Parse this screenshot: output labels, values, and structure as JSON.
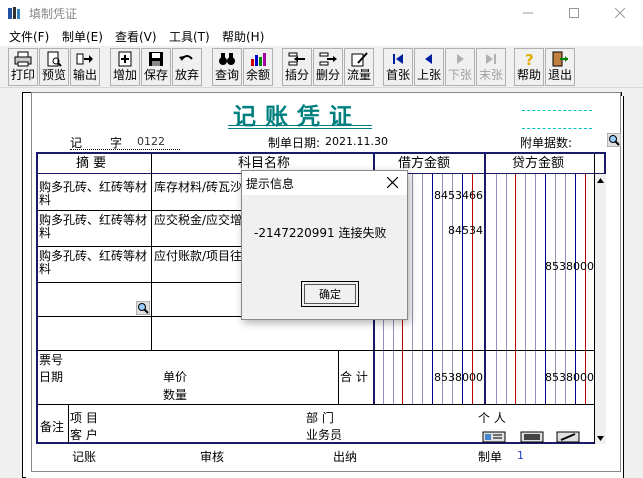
{
  "window": {
    "title": "填制凭证"
  },
  "menu": [
    "文件(F)",
    "制单(E)",
    "查看(V)",
    "工具(T)",
    "帮助(H)"
  ],
  "toolbar": {
    "print": "打印",
    "preview": "预览",
    "export": "输出",
    "add": "增加",
    "save": "保存",
    "discard": "放弃",
    "query": "查询",
    "balance": "余额",
    "insert": "插分",
    "delete": "删分",
    "flow": "流量",
    "first": "首张",
    "prev": "上张",
    "next": "下张",
    "last": "末张",
    "help": "帮助",
    "exit": "退出"
  },
  "voucher": {
    "title": "记账凭证",
    "type_label": "记",
    "num_label": "字",
    "num_value": "0122",
    "date_label": "制单日期:",
    "date_value": "2021.11.30",
    "attach_label": "附单据数:",
    "headers": {
      "summary": "摘 要",
      "account": "科目名称",
      "debit": "借方金额",
      "credit": "贷方金额"
    },
    "rows": [
      {
        "summary": "购多孔砖、红砖等材料",
        "account": "库存材料/砖瓦沙",
        "debit": "8453466",
        "credit": ""
      },
      {
        "summary": "购多孔砖、红砖等材料",
        "account": "应交税金/应交增",
        "debit": "84534",
        "credit": ""
      },
      {
        "summary": "购多孔砖、红砖等材料",
        "account": "应付账款/项目往",
        "debit": "",
        "credit": "8538000"
      },
      {
        "summary": "",
        "account": "",
        "debit": "",
        "credit": ""
      },
      {
        "summary": "",
        "account": "",
        "debit": "",
        "credit": ""
      }
    ],
    "ticket_no": "票号",
    "date": "日期",
    "unit_price": "单价",
    "quantity": "数量",
    "total_label": "合 计",
    "total_debit": "8538000",
    "total_credit": "8538000",
    "remark": "备注",
    "project": "项  目",
    "customer": "客  户",
    "department": "部  门",
    "salesman": "业务员",
    "person": "个  人",
    "bookkeeper": "记账",
    "auditor": "审核",
    "cashier": "出纳",
    "maker": "制单",
    "maker_value": "1"
  },
  "dialog": {
    "title": "提示信息",
    "message": "-2147220991  连接失败",
    "ok": "确定"
  }
}
